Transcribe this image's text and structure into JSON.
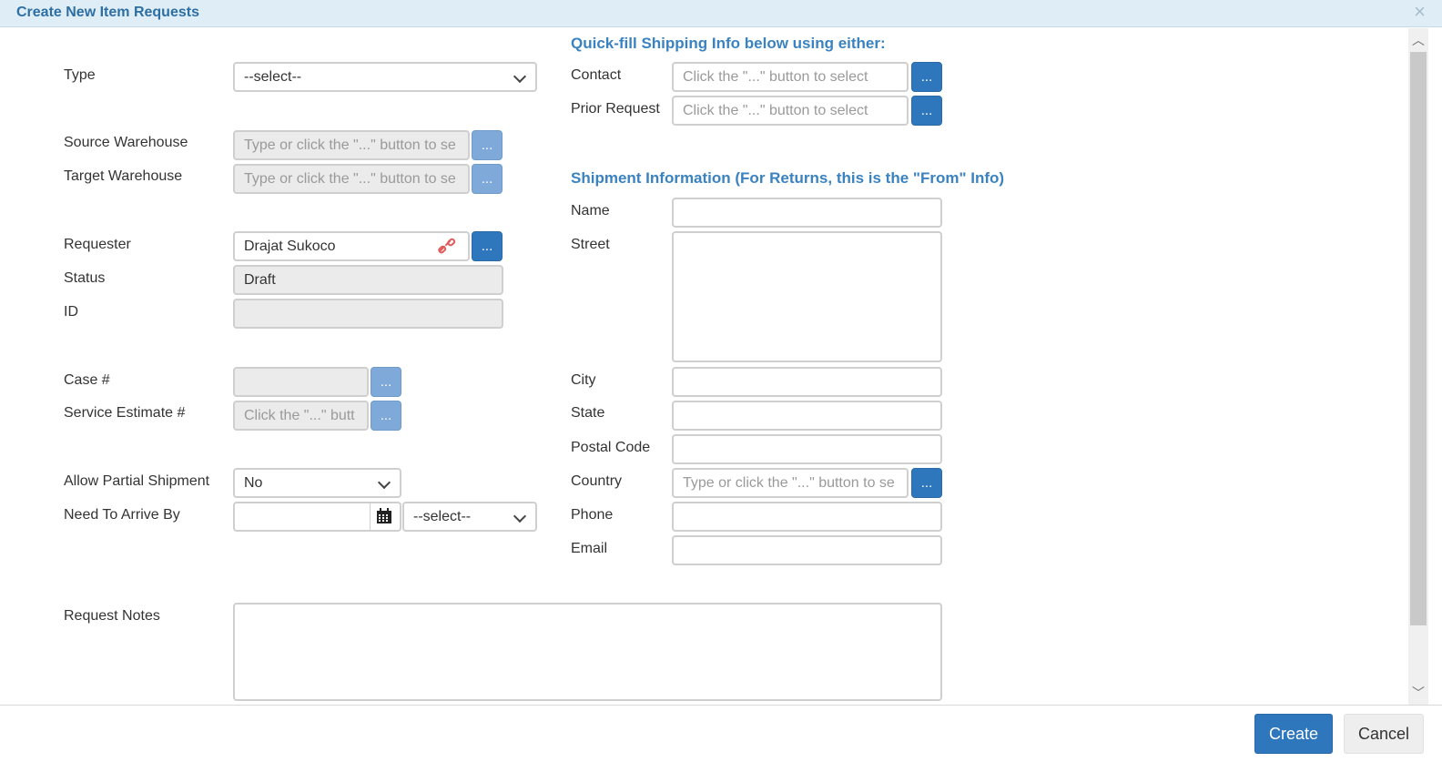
{
  "dialog": {
    "title": "Create New Item Requests",
    "close_symbol": "×"
  },
  "left": {
    "type_label": "Type",
    "type_value": "--select--",
    "source_warehouse_label": "Source Warehouse",
    "source_warehouse_placeholder": "Type or click the \"...\" button to se",
    "target_warehouse_label": "Target Warehouse",
    "target_warehouse_placeholder": "Type or click the \"...\" button to se",
    "requester_label": "Requester",
    "requester_value": "Drajat Sukoco",
    "status_label": "Status",
    "status_value": "Draft",
    "id_label": "ID",
    "id_value": "",
    "case_label": "Case #",
    "service_estimate_label": "Service Estimate #",
    "service_estimate_placeholder": "Click the \"...\" butt",
    "allow_partial_label": "Allow Partial Shipment",
    "allow_partial_value": "No",
    "need_to_arrive_label": "Need To Arrive By",
    "time_value": "--select--",
    "request_notes_label": "Request Notes"
  },
  "right": {
    "quickfill_heading": "Quick-fill Shipping Info below using either:",
    "contact_label": "Contact",
    "contact_placeholder": "Click the \"...\" button to select",
    "prior_request_label": "Prior Request",
    "prior_request_placeholder": "Click the \"...\" button to select",
    "shipment_heading": "Shipment Information (For Returns, this is the \"From\" Info)",
    "name_label": "Name",
    "street_label": "Street",
    "city_label": "City",
    "state_label": "State",
    "postal_label": "Postal Code",
    "country_label": "Country",
    "country_placeholder": "Type or click the \"...\" button to se",
    "phone_label": "Phone",
    "email_label": "Email"
  },
  "buttons": {
    "dots": "...",
    "create": "Create",
    "cancel": "Cancel"
  },
  "colors": {
    "accent": "#2f77bc",
    "heading": "#3a82c0",
    "titlebar": "#dfedf6"
  },
  "icons": {
    "calendar": "calendar-icon",
    "link": "link-icon",
    "chevron": "chevron-down-icon"
  }
}
